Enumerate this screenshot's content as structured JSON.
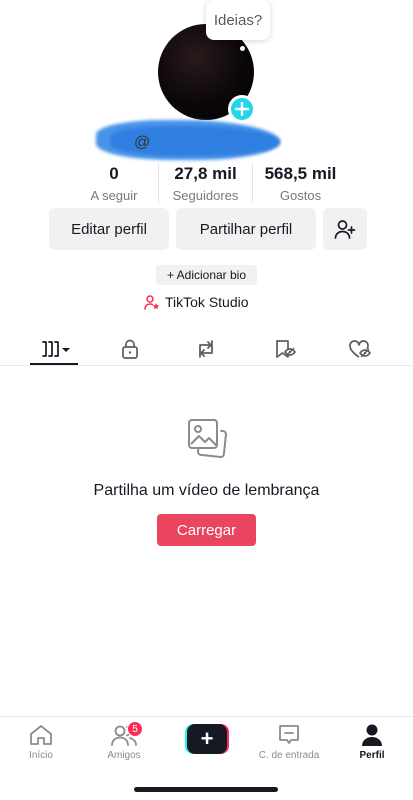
{
  "tooltip": {
    "text": "Ideias?"
  },
  "profile": {
    "username_prefix": "@",
    "stats": [
      {
        "value": "0",
        "label": "A seguir"
      },
      {
        "value": "27,8 mil",
        "label": "Seguidores"
      },
      {
        "value": "568,5 mil",
        "label": "Gostos"
      }
    ]
  },
  "actions": {
    "edit_label": "Editar perfil",
    "share_label": "Partilhar perfil",
    "add_bio_label": "+ Adicionar bio",
    "studio_label": "TikTok Studio"
  },
  "tabs": [
    {
      "icon": "grid-videos-icon",
      "selected": true
    },
    {
      "icon": "lock-icon"
    },
    {
      "icon": "repost-icon"
    },
    {
      "icon": "bookmark-hidden-icon"
    },
    {
      "icon": "liked-hidden-icon"
    }
  ],
  "empty_state": {
    "icon": "photos-icon",
    "title": "Partilha um vídeo de lembrança",
    "button_label": "Carregar"
  },
  "bottom_nav": {
    "items": [
      {
        "label": "Início",
        "icon": "home-icon"
      },
      {
        "label": "Amigos",
        "icon": "friends-icon",
        "badge": "5"
      },
      {
        "label": "",
        "icon": "create-icon"
      },
      {
        "label": "C. de entrada",
        "icon": "inbox-icon"
      },
      {
        "label": "Perfil",
        "icon": "profile-icon",
        "active": true
      }
    ]
  },
  "colors": {
    "accent": "#fe2c55",
    "upload": "#e9455f",
    "avatar_plus": "#20d5ec",
    "text": "#161823"
  }
}
